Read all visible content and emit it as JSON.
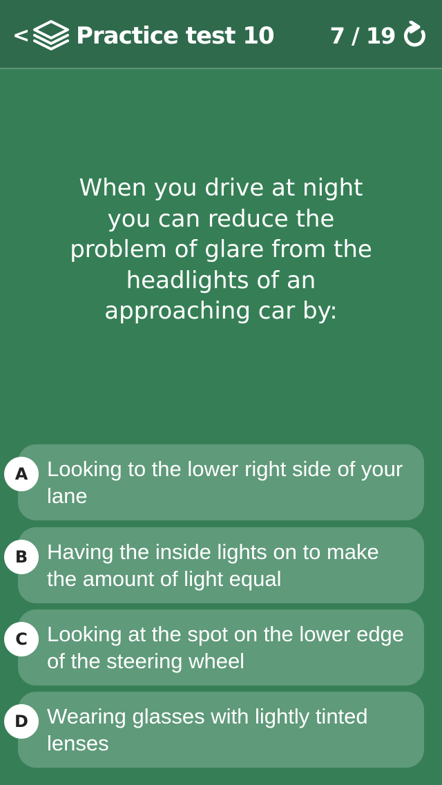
{
  "header": {
    "back_label": "<",
    "title": "Practice test 10",
    "progress": "7 / 19"
  },
  "question": {
    "text": "When you drive at night you can reduce the problem of glare from the headlights of an approaching car by:"
  },
  "answers": [
    {
      "letter": "A",
      "text": "Looking to the lower right side of your lane"
    },
    {
      "letter": "B",
      "text": "Having the inside lights on to make the amount of light equal"
    },
    {
      "letter": "C",
      "text": "Looking at the spot on the lower edge of the steering wheel"
    },
    {
      "letter": "D",
      "text": "Wearing glasses with lightly tinted lenses"
    }
  ],
  "icons": {
    "back": "chevron-left-icon",
    "layers": "layers-icon",
    "refresh": "refresh-icon"
  },
  "colors": {
    "background": "#367f56",
    "header": "#2f6a4c",
    "answer_card": "#5f9a7a",
    "letter_badge": "#ffffff"
  }
}
